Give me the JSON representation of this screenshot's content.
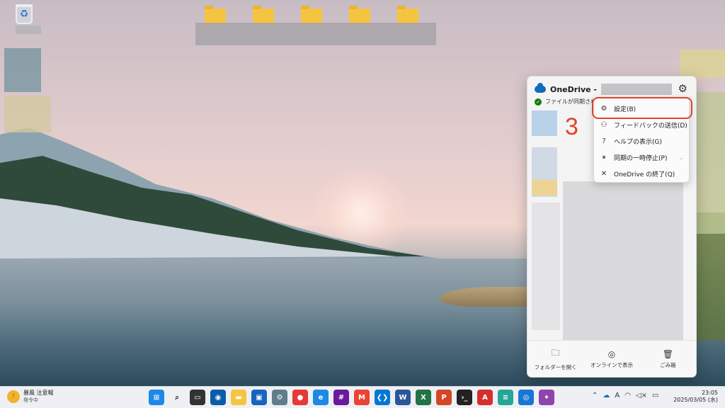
{
  "onedrive": {
    "title": "OneDrive -",
    "status": "ファイルが同期されてい",
    "footer": [
      {
        "label": "フォルダーを開く",
        "icon": "folder-icon"
      },
      {
        "label": "オンラインで表示",
        "icon": "globe-icon"
      },
      {
        "label": "ごみ箱",
        "icon": "trash-icon"
      }
    ]
  },
  "menu": {
    "items": [
      {
        "label": "設定(B)",
        "icon": "gear-icon"
      },
      {
        "label": "フィードバックの送信(D)",
        "icon": "feedback-icon"
      },
      {
        "label": "ヘルプの表示(G)",
        "icon": "help-icon"
      },
      {
        "label": "同期の一時停止(P)",
        "icon": "pause-icon"
      },
      {
        "label": "OneDrive の終了(Q)",
        "icon": "close-icon"
      }
    ]
  },
  "annotation": {
    "step": "3",
    "color": "#e0442a"
  },
  "taskbar": {
    "weather_title": "暴風 注意報",
    "weather_sub": "発令中",
    "time": "23:05",
    "date": "2025/03/05 (水)",
    "ime": "A"
  }
}
